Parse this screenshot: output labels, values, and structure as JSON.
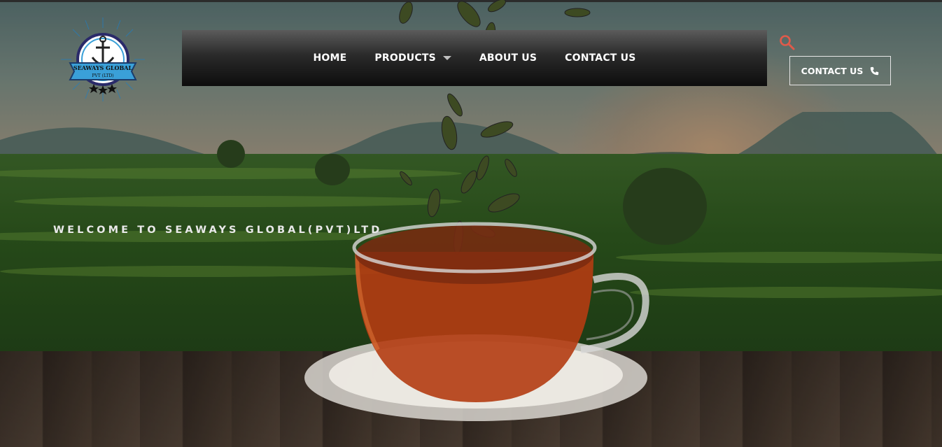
{
  "brand": {
    "logo_text_line1": "SEAWAYS GLOBAL",
    "logo_text_line2": "PVT (LTD)"
  },
  "nav": {
    "items": [
      {
        "label": "HOME"
      },
      {
        "label": "PRODUCTS",
        "has_dropdown": true
      },
      {
        "label": "ABOUT US"
      },
      {
        "label": "CONTACT US"
      }
    ]
  },
  "header_actions": {
    "search_icon": "search-icon",
    "contact_button_label": "CONTACT US",
    "contact_button_icon": "phone-icon"
  },
  "hero": {
    "welcome_text": "WELCOME TO SEAWAYS GLOBAL(PVT)LTD"
  },
  "colors": {
    "accent": "#e05a4a",
    "nav_text": "#ffffff"
  }
}
